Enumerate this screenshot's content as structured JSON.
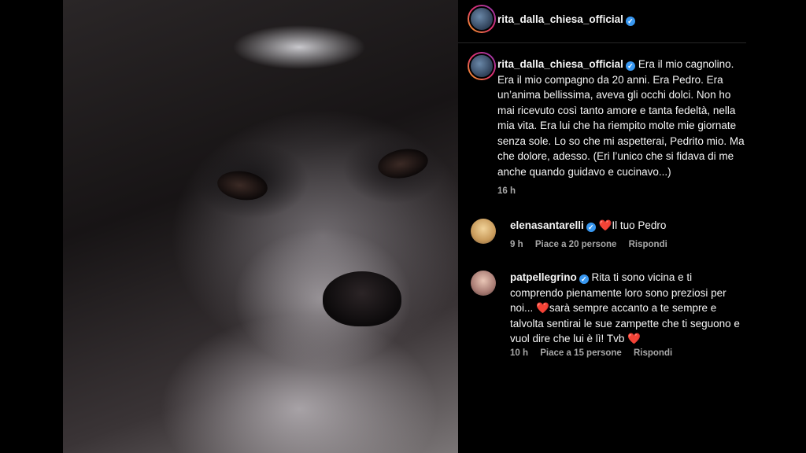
{
  "post": {
    "author": "rita_dalla_chiesa_official",
    "caption": "Era il mio cagnolino. Era il mio compagno da 20 anni. Era Pedro. Era un’anima bellissima, aveva gli occhi dolci. Non ho mai ricevuto così tanto amore e tanta fedeltà, nella mia vita. Era lui che ha riempito molte mie giornate senza sole. Lo so che mi aspetterai, Pedrito mio. Ma che dolore, adesso. (Eri l’unico che si fidava di me anche quando guidavo e cucinavo...)",
    "time": "16 h"
  },
  "comments": [
    {
      "author": "elenasantarelli",
      "heart": "❤️",
      "text": "Il tuo Pedro",
      "time": "9 h",
      "likes": "Piace a 20 persone",
      "reply": "Rispondi"
    },
    {
      "author": "patpellegrino",
      "text_a": "Rita ti sono vicina e ti comprendo pienamente loro sono preziosi per noi...",
      "heart_a": "❤️",
      "text_b": "sarà sempre accanto a te sempre e talvolta sentirai le sue zampette che ti seguono e vuol dire che lui è lì! Tvb",
      "heart_b": "❤️",
      "time": "10 h",
      "likes": "Piace a 15 persone",
      "reply": "Rispondi"
    }
  ],
  "icons": {
    "verified": "verified-badge-icon"
  },
  "colors": {
    "accent_blue": "#3897f0",
    "heart_red": "#ed4956",
    "muted": "#a8a8a8"
  }
}
